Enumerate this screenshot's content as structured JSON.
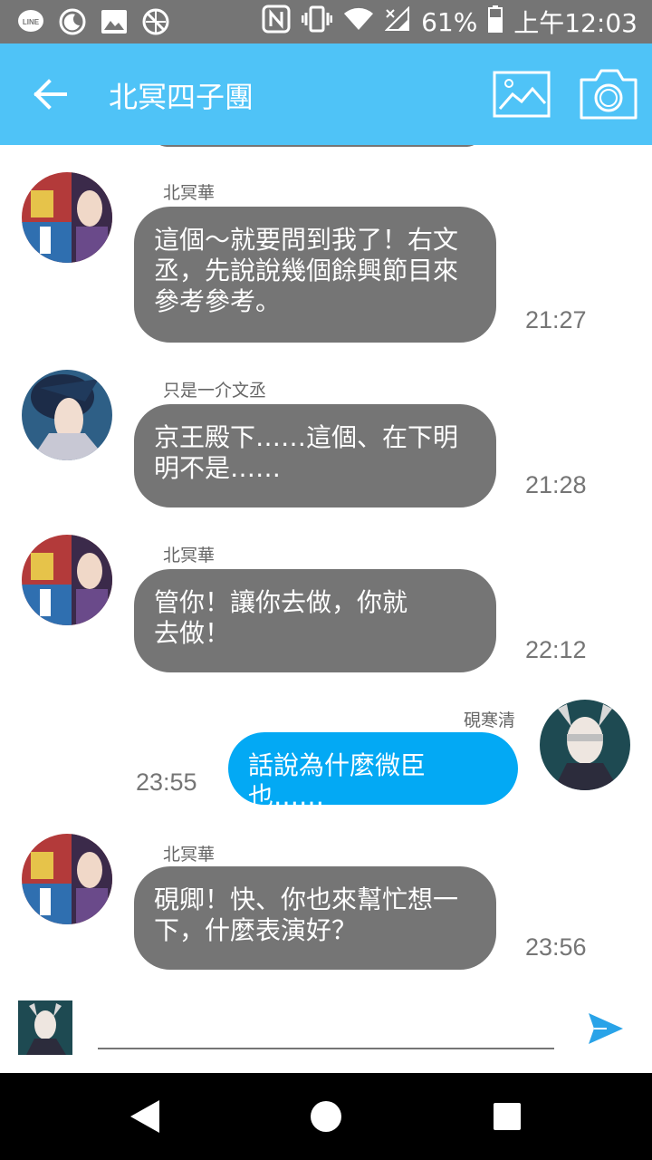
{
  "status_bar": {
    "battery": "61%",
    "time": "上午12:03",
    "icons": [
      "line-icon",
      "moon-icon",
      "image-icon",
      "blocked-icon",
      "nfc-icon",
      "vibrate-icon",
      "wifi-icon",
      "signal-icon",
      "battery-icon"
    ]
  },
  "app_bar": {
    "title": "北冥四子團",
    "back_icon": "arrow-back-icon",
    "image_icon": "image-icon",
    "camera_icon": "camera-icon",
    "color": "#4fc3f7"
  },
  "messages": [
    {
      "sender": "北冥華",
      "text_lines": [
        "這個～就要問到我了！右文",
        "丞，先說說幾個餘興節目來",
        "參考參考。"
      ],
      "time": "21:27",
      "direction": "in"
    },
    {
      "sender": "只是一介文丞",
      "text_lines": [
        "京王殿下……這個、在下明",
        "明不是……"
      ],
      "time": "21:28",
      "direction": "in"
    },
    {
      "sender": "北冥華",
      "text_lines": [
        "管你！讓你去做，你就",
        "去做！"
      ],
      "time": "22:12",
      "direction": "in"
    },
    {
      "sender": "硯寒清",
      "text_lines": [
        "話說為什麼微臣也……"
      ],
      "time": "23:55",
      "direction": "out"
    },
    {
      "sender": "北冥華",
      "text_lines": [
        "硯卿！快、你也來幫忙想一",
        "下，什麼表演好？"
      ],
      "time": "23:56",
      "direction": "in"
    }
  ],
  "input": {
    "placeholder": "",
    "value": "",
    "send_icon": "send-icon"
  },
  "nav_bar": {
    "icons": [
      "back-triangle-icon",
      "home-circle-icon",
      "recents-square-icon"
    ]
  },
  "colors": {
    "incoming_bubble": "#757575",
    "outgoing_bubble": "#03a9f4",
    "accent": "#4fc3f7"
  }
}
